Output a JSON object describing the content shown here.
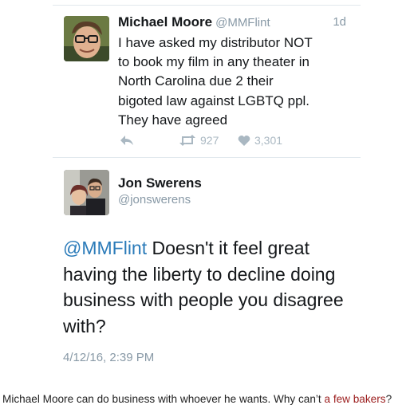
{
  "tweet1": {
    "name": "Michael Moore",
    "handle": "@MMFlint",
    "time": "1d",
    "text": "I have asked my distributor NOT\nto book my film in any theater in\nNorth Carolina due 2 their\nbigoted law against LGBTQ ppl.\nThey have agreed",
    "retweets": "927",
    "likes": "3,301"
  },
  "tweet2": {
    "name": "Jon Swerens",
    "handle": "@jonswerens",
    "mention": "@MMFlint",
    "text": " Doesn't it feel great having the liberty to decline doing business with people you disagree with?",
    "date": "4/12/16, 2:39 PM"
  },
  "caption": {
    "text_before": "Michael Moore can do business with whoever he wants. Why can’t ",
    "link_text": "a few bakers",
    "text_after": "?"
  },
  "colors": {
    "link_blue": "#2b7bb9",
    "meta_gray": "#8899a6",
    "action_gray": "#aab8c2",
    "caption_link": "#9b1c1c"
  },
  "icons": {
    "reply": "reply-icon",
    "retweet": "retweet-icon",
    "like": "heart-icon"
  }
}
